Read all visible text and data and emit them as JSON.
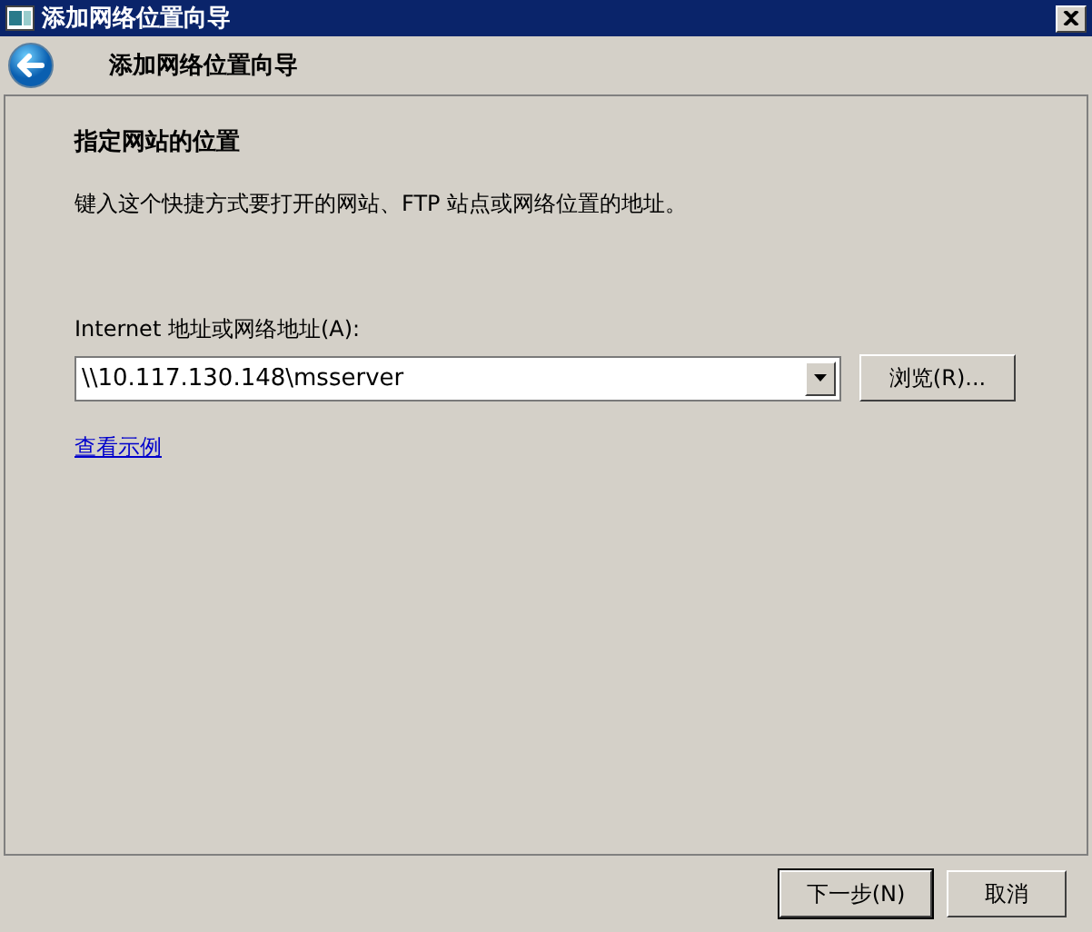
{
  "window": {
    "title": "添加网络位置向导"
  },
  "header": {
    "title": "添加网络位置向导"
  },
  "page": {
    "heading": "指定网站的位置",
    "description": "键入这个快捷方式要打开的网站、FTP 站点或网络位置的地址。",
    "address": {
      "label": "Internet 地址或网络地址(A):",
      "value": "\\\\10.117.130.148\\msserver"
    },
    "browse_button": "浏览(R)...",
    "link": "查看示例"
  },
  "buttons": [
    {
      "label": "下一步(N)",
      "default": true
    },
    {
      "label": "取消",
      "default": false
    }
  ]
}
